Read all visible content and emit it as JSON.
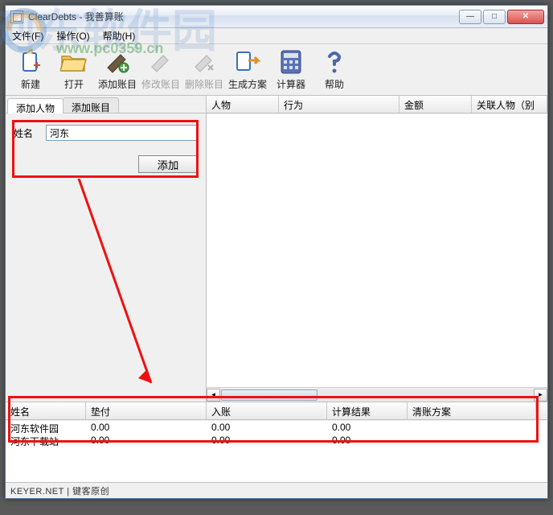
{
  "window": {
    "title": "ClearDebts - 我善算账"
  },
  "menu": {
    "file": "文件(F)",
    "operate": "操作(O)",
    "help": "帮助(H)"
  },
  "toolbar": {
    "new": "新建",
    "open": "打开",
    "add_item": "添加账目",
    "edit_item": "修改账目",
    "delete_item": "删除账目",
    "generate": "生成方案",
    "calculator": "计算器",
    "help": "帮助"
  },
  "left_tabs": {
    "add_person": "添加人物",
    "add_item": "添加账目"
  },
  "form": {
    "name_label": "姓名",
    "name_value": "河东",
    "add_btn": "添加"
  },
  "upper_grid": {
    "cols": {
      "person": "人物",
      "action": "行为",
      "amount": "金额",
      "related": "关联人物（别"
    }
  },
  "lower_grid": {
    "cols": {
      "name": "姓名",
      "paid": "垫付",
      "received": "入账",
      "result": "计算结果",
      "plan": "清账方案"
    },
    "rows": [
      {
        "name": "河东软件园",
        "paid": "0.00",
        "received": "0.00",
        "result": "0.00",
        "plan": ""
      },
      {
        "name": "河东下载站",
        "paid": "0.00",
        "received": "0.00",
        "result": "0.00",
        "plan": ""
      }
    ]
  },
  "status": "KEYER.NET | 键客原创",
  "watermark": {
    "text": "河东软件园",
    "url": "www.pc0359.cn"
  },
  "lower_col_widths": {
    "name": "100px",
    "paid": "150px",
    "received": "150px",
    "result": "100px",
    "plan": "160px"
  }
}
